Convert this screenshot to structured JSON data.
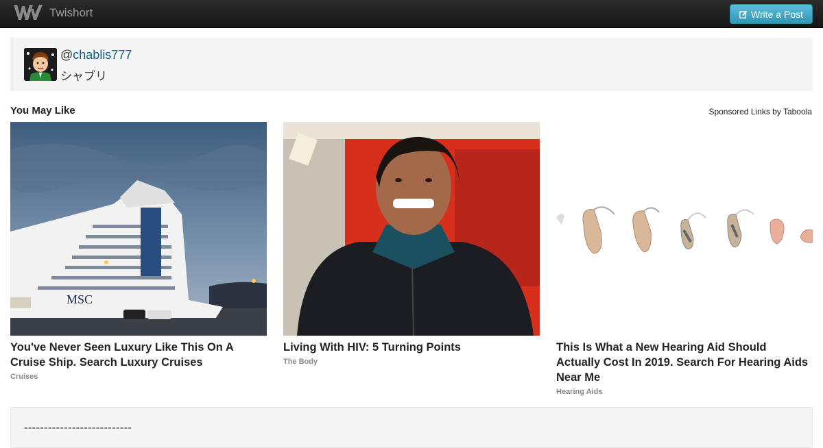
{
  "navbar": {
    "brand": "Twishort",
    "logo_icon": "twishort-logo-icon",
    "write_button": "Write a Post",
    "write_icon": "edit-icon"
  },
  "profile": {
    "at": "@",
    "handle": "chablis777",
    "display_name": "シャブリ"
  },
  "recommendations": {
    "heading": "You May Like",
    "sponsored": "Sponsored Links by Taboola",
    "cards": [
      {
        "title": "You've Never Seen Luxury Like This On A Cruise Ship. Search Luxury Cruises",
        "source": "Cruises",
        "image_text": "MSC"
      },
      {
        "title": "Living With HIV: 5 Turning Points",
        "source": "The Body"
      },
      {
        "title": "This Is What a New Hearing Aid Should Actually Cost In 2019. Search For Hearing Aids Near Me",
        "source": "Hearing Aids"
      }
    ]
  },
  "post": {
    "text": "---------------------------"
  },
  "colors": {
    "navbar": "#222222",
    "button": "#49afcd",
    "link": "#0d5f8c"
  }
}
